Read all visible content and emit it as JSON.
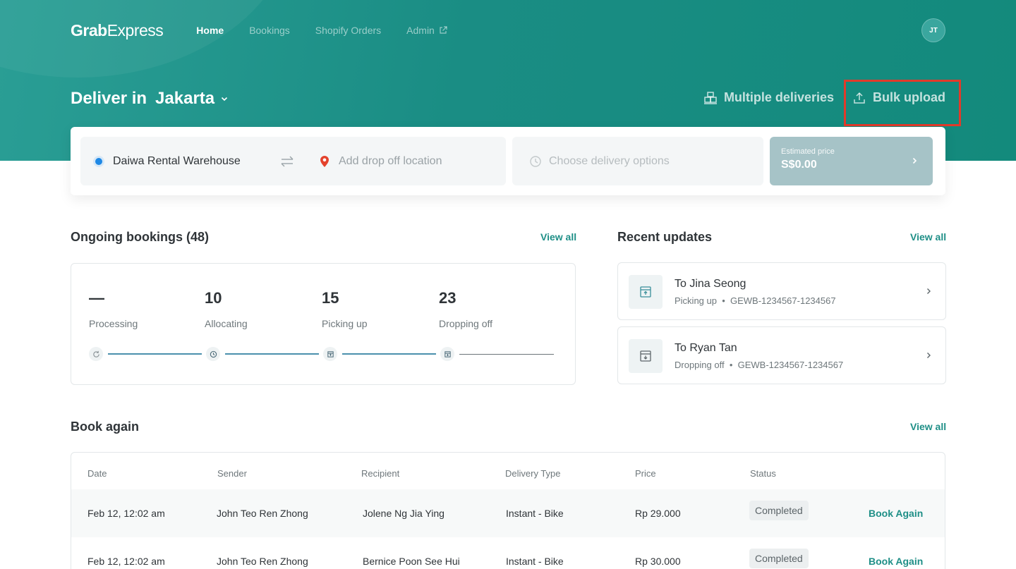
{
  "app": {
    "logo_prefix": "Grab",
    "logo_suffix": "Express"
  },
  "nav": {
    "items": [
      {
        "label": "Home",
        "active": true
      },
      {
        "label": "Bookings",
        "active": false
      },
      {
        "label": "Shopify Orders",
        "active": false
      },
      {
        "label": "Admin",
        "active": false,
        "icon": "external-link-icon"
      }
    ],
    "avatar_initials": "JT"
  },
  "deliver": {
    "prefix": "Deliver in",
    "city": "Jakarta"
  },
  "actions": {
    "multiple_label": "Multiple deliveries",
    "bulk_label": "Bulk upload",
    "highlight_color": "#e23a2a"
  },
  "booker": {
    "pickup": "Daiwa Rental Warehouse",
    "dropoff_placeholder": "Add drop off location",
    "options_placeholder": "Choose delivery options",
    "price_label": "Estimated price",
    "price_value": "S$0.00"
  },
  "ongoing": {
    "title": "Ongoing bookings (48)",
    "view_all": "View all",
    "stats": [
      {
        "value": "—",
        "label": "Processing"
      },
      {
        "value": "10",
        "label": "Allocating"
      },
      {
        "value": "15",
        "label": "Picking up"
      },
      {
        "value": "23",
        "label": "Dropping off"
      }
    ]
  },
  "updates": {
    "title": "Recent updates",
    "view_all": "View all",
    "items": [
      {
        "name": "To Jina Seong",
        "status": "Picking up",
        "code": "GEWB-1234567-1234567",
        "icon": "box-up-icon"
      },
      {
        "name": "To Ryan Tan",
        "status": "Dropping off",
        "code": "GEWB-1234567-1234567",
        "icon": "box-down-icon"
      }
    ]
  },
  "book_again": {
    "title": "Book again",
    "view_all": "View all",
    "columns": [
      "Date",
      "Sender",
      "Recipient",
      "Delivery Type",
      "Price",
      "Status"
    ],
    "rows": [
      {
        "date": "Feb 12, 12:02 am",
        "sender": "John Teo Ren Zhong",
        "recipient": "Jolene Ng Jia Ying",
        "type": "Instant - Bike",
        "price": "Rp 29.000",
        "status": "Completed",
        "action": "Book Again"
      },
      {
        "date": "Feb 12, 12:02 am",
        "sender": "John Teo Ren Zhong",
        "recipient": "Bernice Poon See Hui",
        "type": "Instant - Bike",
        "price": "Rp 30.000",
        "status": "Completed",
        "action": "Book Again"
      }
    ]
  },
  "colors": {
    "brand_teal": "#1a8d84",
    "accent_link": "#1f8f87",
    "progress_line": "#4b90ad"
  }
}
